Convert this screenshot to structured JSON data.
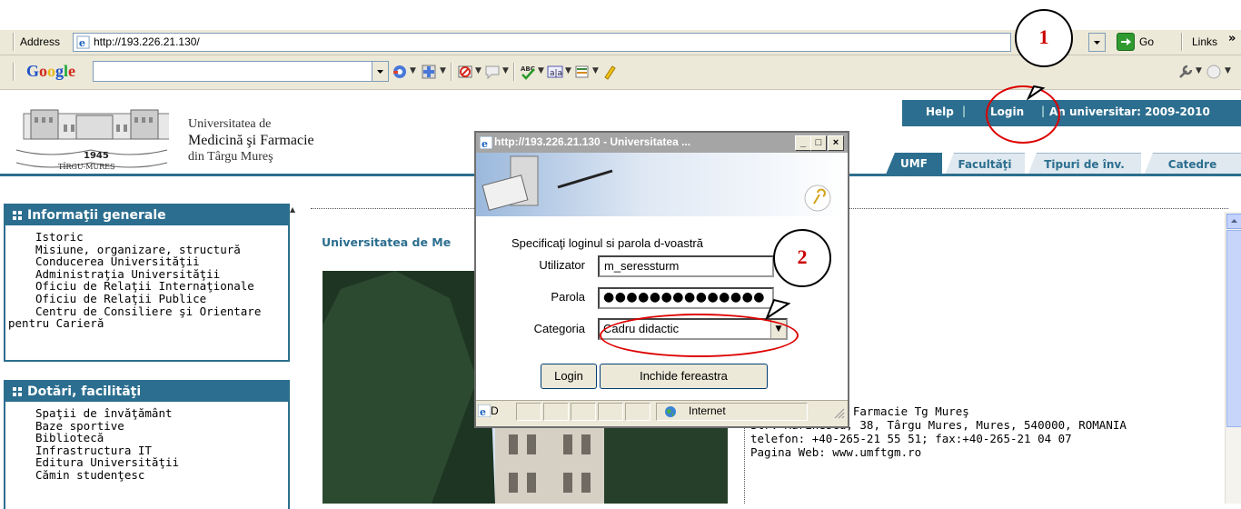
{
  "browser": {
    "address_label": "Address",
    "address_url": "http://193.226.21.130/",
    "go_label": "Go",
    "links_label": "Links",
    "links_chevron": "»",
    "google_label": "Google"
  },
  "site": {
    "logo_year": "1945",
    "logo_city": "TÎRGU-MUREȘ",
    "university_line1": "Universitatea de",
    "university_line2": "Medicină şi Farmacie",
    "university_line3": "din Târgu Mureş",
    "top_links": {
      "help": "Help",
      "separator": "|",
      "login": "Login",
      "year": "An universitar: 2009-2010"
    },
    "tabs": [
      "UMF",
      "Facultăţi",
      "Tipuri de înv.",
      "Catedre"
    ]
  },
  "nav": {
    "general": {
      "title": "Informaţii generale",
      "items": [
        "Istoric",
        "Misiune, organizare, structură",
        "Conducerea Universităţii",
        "Administraţia Universităţii",
        "Oficiu de Relaţii Internaţionale",
        "Oficiu de Relaţii Publice",
        "Centru de Consiliere şi Orientare",
        "pentru Carieră"
      ]
    },
    "facilities": {
      "title": "Dotări, facilităţi",
      "items": [
        "Spaţii de învăţământ",
        "Baze sportive",
        "Bibliotecă",
        "Infrastructura IT",
        "Editura Universităţii",
        "Cămin studenţesc"
      ]
    }
  },
  "main": {
    "title": "Universitatea de Me",
    "contact_lines": [
      "de Medicină şi Farmacie Tg Mureş",
      "Str. Marinescu, 38, Târgu Mures, Mures, 540000, ROMANIA",
      "telefon: +40-265-21 55 51; fax:+40-265-21 04 07",
      "Pagina Web: www.umftgm.ro"
    ]
  },
  "popup": {
    "title": "http://193.226.21.130 - Universitatea ...",
    "instruction": "Specificaţi loginul si parola d-voastră",
    "user_label": "Utilizator",
    "user_value": "m_seressturm",
    "pass_label": "Parola",
    "pass_value": "●●●●●●●●●●●●●●",
    "category_label": "Categoria",
    "category_value": "Cadru didactic",
    "login_button": "Login",
    "close_button": "Inchide fereastra",
    "status_text": "D",
    "status_zone": "Internet"
  },
  "annotations": [
    "1",
    "2"
  ],
  "colors": {
    "brand": "#2c6e8f",
    "annotation_red": "#d00000"
  }
}
